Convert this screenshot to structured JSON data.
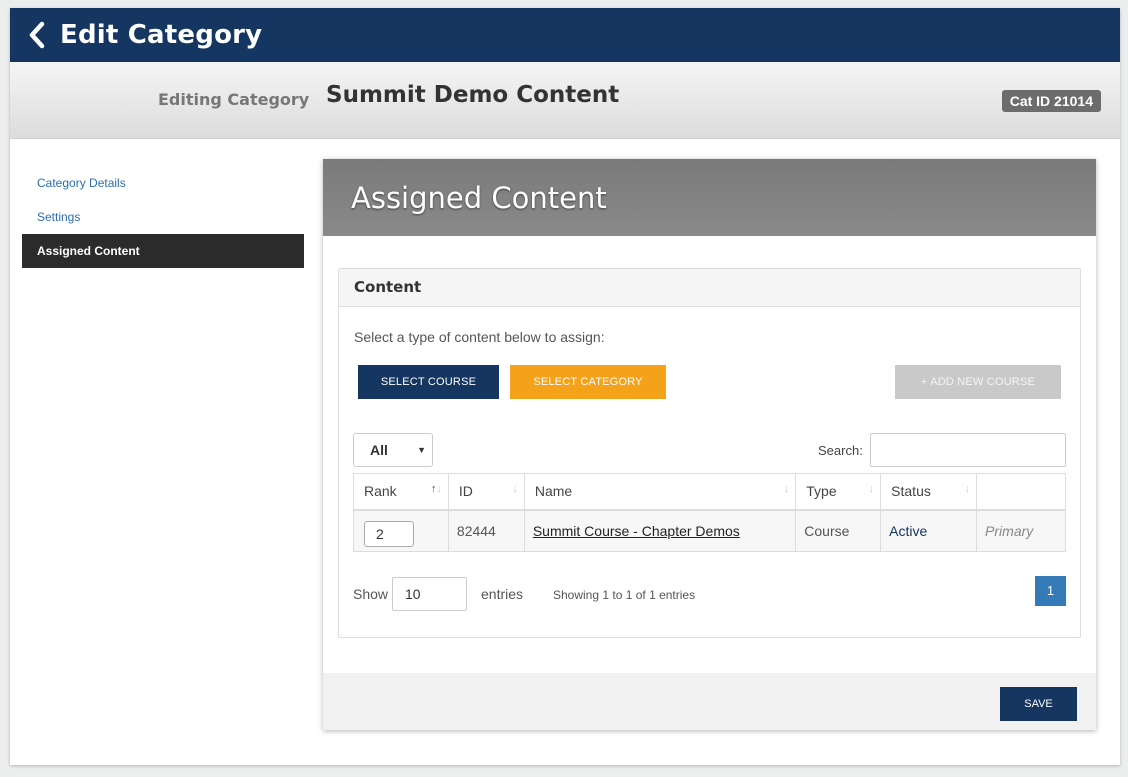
{
  "header": {
    "title": "Edit Category",
    "back_icon": "chevron-left-icon"
  },
  "subheader": {
    "editing_label": "Editing Category",
    "category_name": "Summit Demo Content",
    "cat_id_badge": "Cat ID 21014"
  },
  "sidebar": {
    "items": [
      {
        "label": "Category Details",
        "active": false
      },
      {
        "label": "Settings",
        "active": false
      },
      {
        "label": "Assigned Content",
        "active": true
      }
    ]
  },
  "panel": {
    "title": "Assigned Content",
    "content_box_title": "Content",
    "instruction": "Select a type of content below to assign:",
    "buttons": {
      "select_course": "SELECT COURSE",
      "select_category": "SELECT CATEGORY",
      "add_new_course": "+ ADD NEW COURSE"
    },
    "filter": {
      "selected": "All"
    },
    "search": {
      "label": "Search:",
      "value": ""
    },
    "table": {
      "columns": [
        "Rank",
        "ID",
        "Name",
        "Type",
        "Status",
        ""
      ],
      "rows": [
        {
          "rank": "2",
          "id": "82444",
          "name": "Summit Course - Chapter Demos",
          "type": "Course",
          "status": "Active",
          "note": "Primary"
        }
      ]
    },
    "pagination": {
      "show_label": "Show",
      "page_size": "10",
      "entries_label": "entries",
      "info": "Showing 1 to 1 of 1 entries",
      "current_page": "1"
    },
    "save_label": "SAVE"
  },
  "colors": {
    "navy": "#143660",
    "orange": "#f5a21b",
    "link_blue": "#2a6fb0",
    "page_blue": "#337ab7"
  }
}
